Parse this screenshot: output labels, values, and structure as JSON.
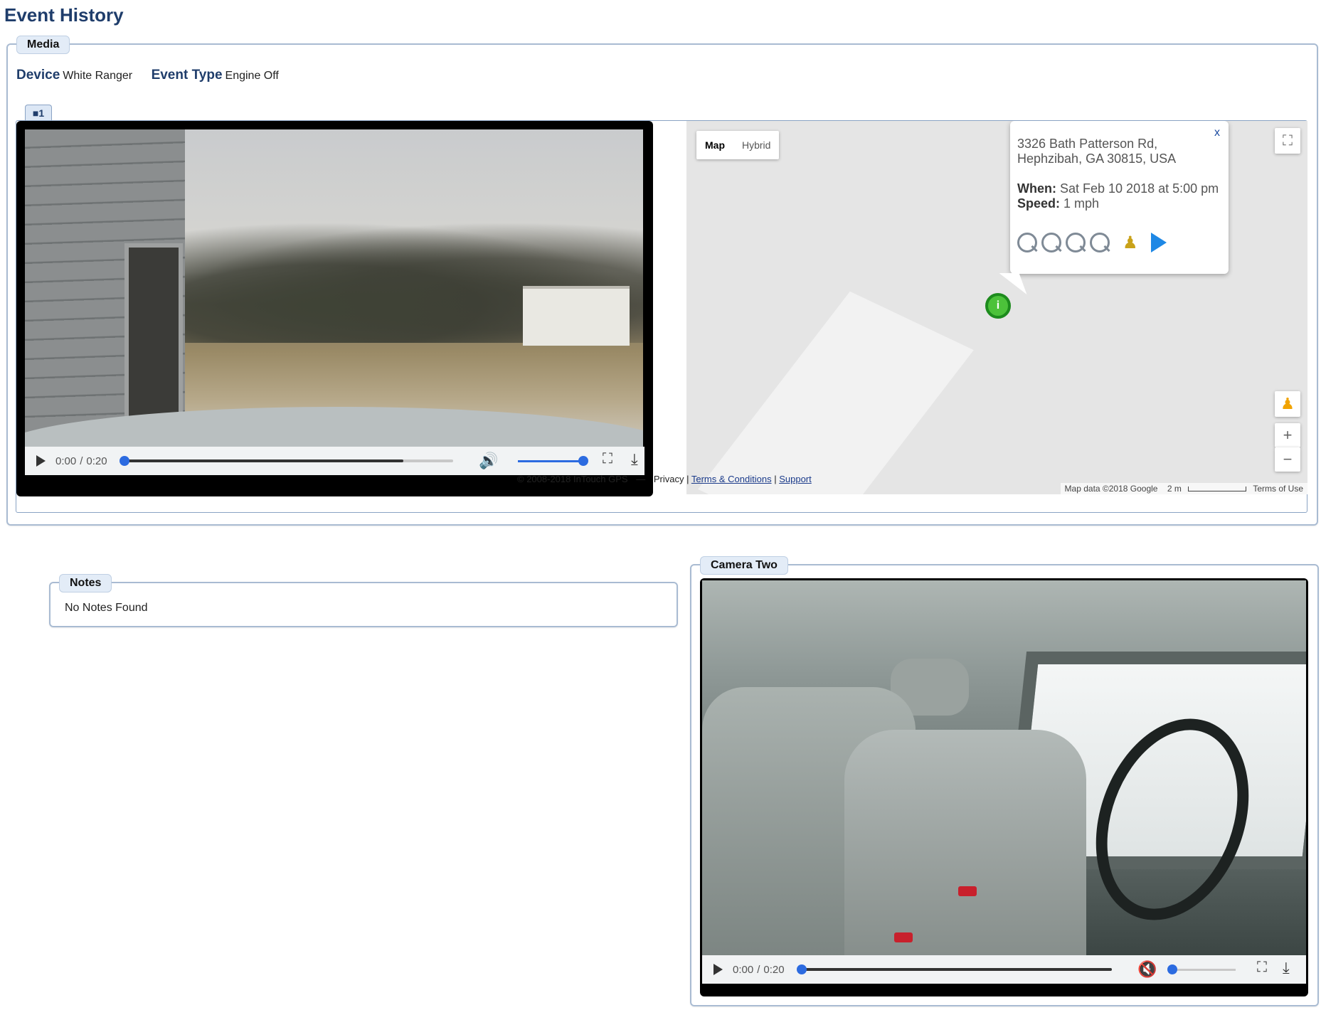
{
  "page": {
    "title": "Event History"
  },
  "media": {
    "legend": "Media",
    "device_label": "Device",
    "device_value": "White Ranger",
    "event_type_label": "Event Type",
    "event_type_value": "Engine Off",
    "camera_tab_label": "1"
  },
  "video1": {
    "time_current": "0:00",
    "time_separator": "/",
    "time_total": "0:20",
    "buffered_fraction": 0.85,
    "volume_fraction": 1.0,
    "muted": false
  },
  "map": {
    "type_buttons": [
      "Map",
      "Hybrid"
    ],
    "active_type": "Map",
    "info": {
      "close": "x",
      "address": "3326 Bath Patterson Rd, Hephzibah, GA 30815, USA",
      "when_label": "When:",
      "when_value": "Sat Feb 10 2018 at 5:00 pm",
      "speed_label": "Speed:",
      "speed_value": "1 mph"
    },
    "zoom_in": "+",
    "zoom_out": "−",
    "attribution": "Map data ©2018 Google",
    "scale": "2 m",
    "terms": "Terms of Use"
  },
  "footer": {
    "copyright": "© 2008-2018 InTouch GPS",
    "dash": "—",
    "privacy": "Privacy",
    "sep1": "|",
    "terms": "Terms & Conditions",
    "sep2": "|",
    "support": "Support"
  },
  "notes": {
    "legend": "Notes",
    "empty_text": "No Notes Found"
  },
  "camera_two": {
    "legend": "Camera Two",
    "time_current": "0:00",
    "time_separator": "/",
    "time_total": "0:20",
    "buffered_fraction": 1.0,
    "volume_fraction": 0.0,
    "muted": true
  },
  "colors": {
    "accent": "#2c6be0",
    "title": "#1f3d6b",
    "panel_border": "#a9bbd2"
  }
}
